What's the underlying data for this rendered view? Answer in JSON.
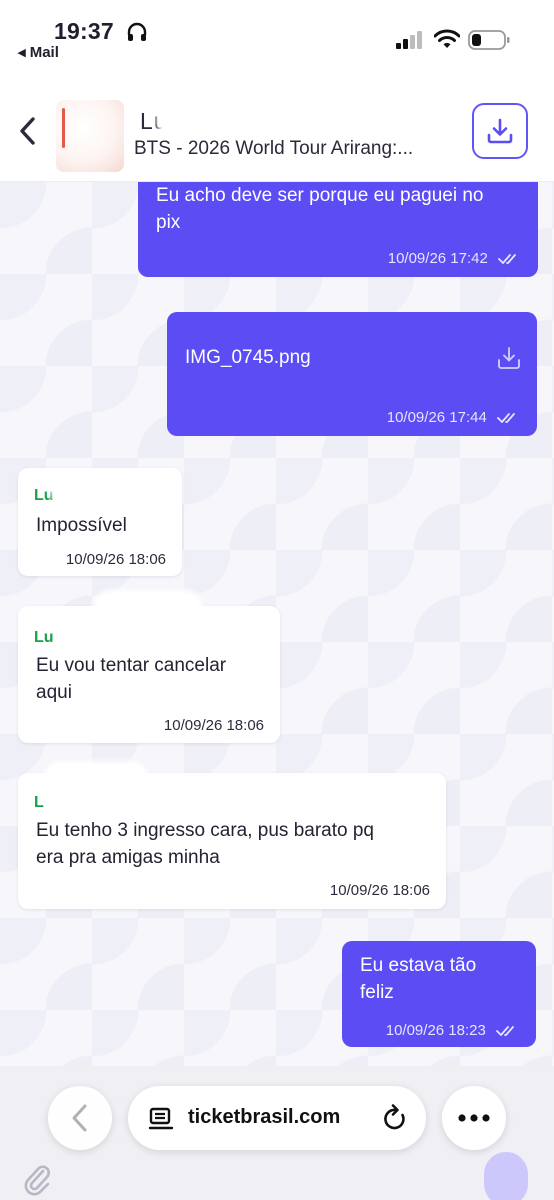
{
  "status_bar": {
    "time": "19:37",
    "back_app": "◂ Mail"
  },
  "header": {
    "contact_name": "Lu         el",
    "event_title": "BTS -  2026 World Tour  Arirang:..."
  },
  "messages": [
    {
      "direction": "out",
      "text_lines": [
        "Eu acho deve ser porque eu paguei no",
        "pix"
      ],
      "timestamp": "10/09/26 17:42"
    },
    {
      "direction": "out",
      "file_name": "IMG_0745.png",
      "timestamp": "10/09/26 17:44"
    },
    {
      "direction": "in",
      "sender": "Lu",
      "text_lines": [
        "Impossível"
      ],
      "timestamp": "10/09/26 18:06"
    },
    {
      "direction": "in",
      "sender": "Lu",
      "text_lines": [
        "Eu vou tentar cancelar",
        "aqui"
      ],
      "timestamp": "10/09/26 18:06"
    },
    {
      "direction": "in",
      "sender": "L",
      "text_lines": [
        "Eu tenho 3 ingresso cara, pus barato pq",
        "era pra amigas minha"
      ],
      "timestamp": "10/09/26 18:06"
    },
    {
      "direction": "out",
      "text_lines": [
        "Eu estava tão",
        "feliz"
      ],
      "timestamp": "10/09/26 18:23"
    }
  ],
  "safari": {
    "url": "ticketbrasil.com"
  },
  "colors": {
    "accent": "#5b4cf3",
    "sender_name": "#16a34a",
    "background": "#f6f6fb"
  },
  "icons": [
    "headphones-icon",
    "signal-icon",
    "wifi-icon",
    "battery-icon",
    "chevron-left-icon",
    "download-icon",
    "double-check-icon",
    "paperclip-icon",
    "reader-icon",
    "reload-icon",
    "more-icon"
  ]
}
